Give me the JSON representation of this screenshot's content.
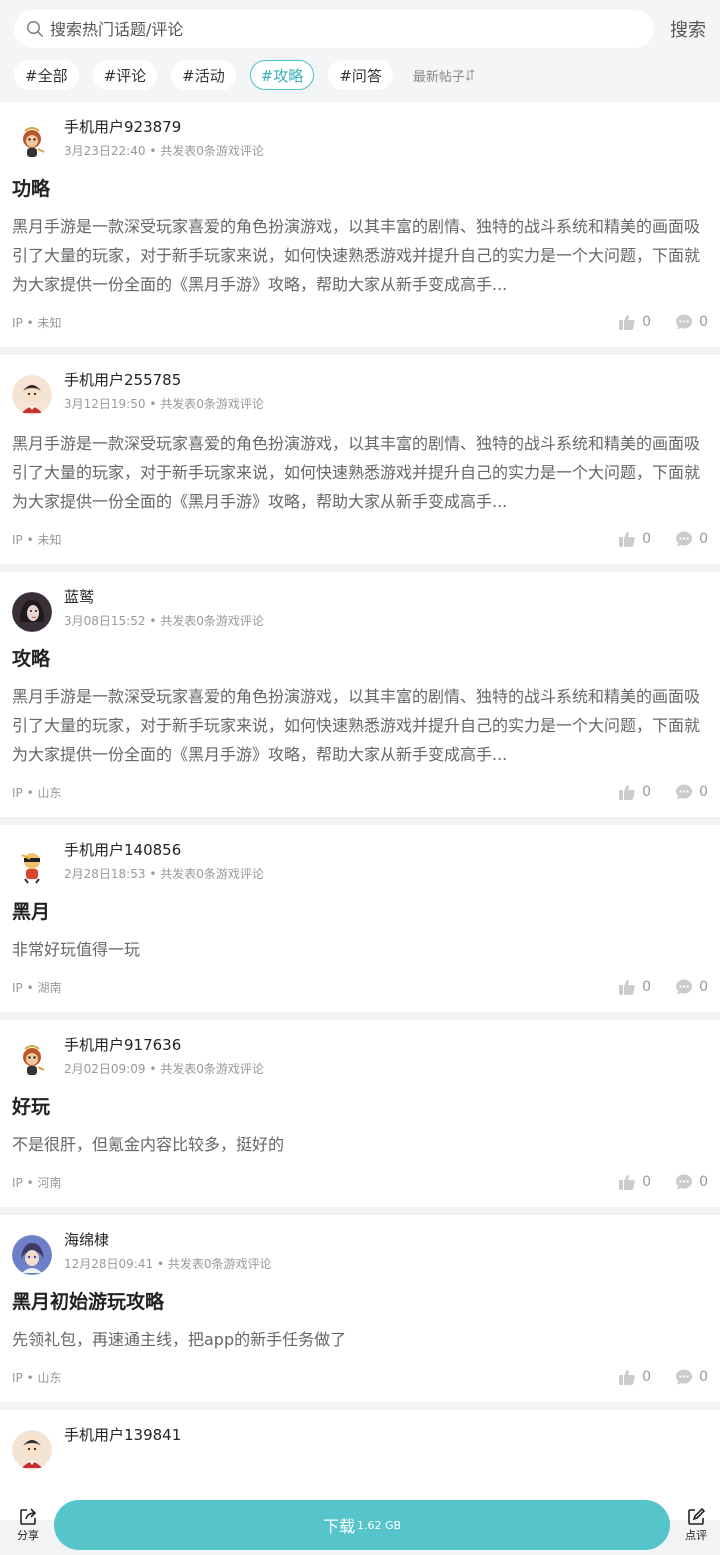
{
  "search": {
    "placeholder": "搜索热门话题/评论",
    "button": "搜索"
  },
  "filters": [
    {
      "label": "#全部",
      "active": false
    },
    {
      "label": "#评论",
      "active": false
    },
    {
      "label": "#活动",
      "active": false
    },
    {
      "label": "#攻略",
      "active": true
    },
    {
      "label": "#问答",
      "active": false
    }
  ],
  "sort_label": "最新帖子",
  "posts": [
    {
      "user": "手机用户923879",
      "time": "3月23日22:40",
      "count_text": "共发表0条游戏评论",
      "title": "功略",
      "content": "黑月手游是一款深受玩家喜爱的角色扮演游戏，以其丰富的剧情、独特的战斗系统和精美的画面吸引了大量的玩家，对于新手玩家来说，如何快速熟悉游戏并提升自己的实力是一个大问题，下面就为大家提供一份全面的《黑月手游》攻略，帮助大家从新手变成高手...",
      "ip": "IP • 未知",
      "likes": "0",
      "comments": "0",
      "avatar": "monkey"
    },
    {
      "user": "手机用户255785",
      "time": "3月12日19:50",
      "count_text": "共发表0条游戏评论",
      "title": "",
      "content": "黑月手游是一款深受玩家喜爱的角色扮演游戏，以其丰富的剧情、独特的战斗系统和精美的画面吸引了大量的玩家，对于新手玩家来说，如何快速熟悉游戏并提升自己的实力是一个大问题，下面就为大家提供一份全面的《黑月手游》攻略，帮助大家从新手变成高手...",
      "ip": "IP • 未知",
      "likes": "0",
      "comments": "0",
      "avatar": "boy"
    },
    {
      "user": "蓝鹫",
      "time": "3月08日15:52",
      "count_text": "共发表0条游戏评论",
      "title": "攻略",
      "content": "黑月手游是一款深受玩家喜爱的角色扮演游戏，以其丰富的剧情、独特的战斗系统和精美的画面吸引了大量的玩家，对于新手玩家来说，如何快速熟悉游戏并提升自己的实力是一个大问题，下面就为大家提供一份全面的《黑月手游》攻略，帮助大家从新手变成高手...",
      "ip": "IP • 山东",
      "likes": "0",
      "comments": "0",
      "avatar": "girl"
    },
    {
      "user": "手机用户140856",
      "time": "2月28日18:53",
      "count_text": "共发表0条游戏评论",
      "title": "黑月",
      "content": "非常好玩值得一玩",
      "ip": "IP • 湖南",
      "likes": "0",
      "comments": "0",
      "avatar": "ninja"
    },
    {
      "user": "手机用户917636",
      "time": "2月02日09:09",
      "count_text": "共发表0条游戏评论",
      "title": "好玩",
      "content": "不是很肝，但氪金内容比较多，挺好的",
      "ip": "IP • 河南",
      "likes": "0",
      "comments": "0",
      "avatar": "monkey"
    },
    {
      "user": "海绵棣",
      "time": "12月28日09:41",
      "count_text": "共发表0条游戏评论",
      "title": "黑月初始游玩攻略",
      "content": "先领礼包，再速通主线，把app的新手任务做了",
      "ip": "IP • 山东",
      "likes": "0",
      "comments": "0",
      "avatar": "anime"
    },
    {
      "user": "手机用户139841",
      "time": "",
      "count_text": "",
      "title": "",
      "content": "",
      "ip": "",
      "likes": "",
      "comments": "",
      "avatar": "boy"
    }
  ],
  "bottom": {
    "share": "分享",
    "download": "下载",
    "size": "1.62 GB",
    "review": "点评"
  },
  "colors": {
    "accent": "#55c4cb"
  }
}
